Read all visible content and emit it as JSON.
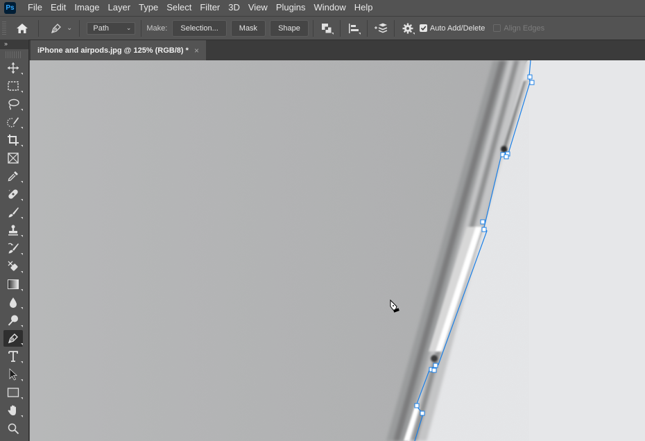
{
  "app": {
    "logo_text": "Ps",
    "menu": [
      "File",
      "Edit",
      "Image",
      "Layer",
      "Type",
      "Select",
      "Filter",
      "3D",
      "View",
      "Plugins",
      "Window",
      "Help"
    ]
  },
  "options_bar": {
    "home_icon": "home-icon",
    "tool_icon": "pen-tool-icon",
    "mode_select": {
      "value": "Path"
    },
    "make_label": "Make:",
    "buttons": {
      "selection": "Selection...",
      "mask": "Mask",
      "shape": "Shape"
    },
    "icons": [
      "path-operations-icon",
      "path-alignment-icon",
      "path-arrangement-icon",
      "gear-icon"
    ],
    "auto_add_delete": {
      "label": "Auto Add/Delete",
      "checked": true
    },
    "align_edges": {
      "label": "Align Edges",
      "checked": false,
      "enabled": false
    }
  },
  "document_tab": {
    "title": "iPhone and airpods.jpg @ 125% (RGB/8) *",
    "close_glyph": "×"
  },
  "toolbar": {
    "collapse_glyph": "››",
    "tools": [
      {
        "name": "move-tool",
        "active": false
      },
      {
        "name": "rectangular-marquee-tool",
        "active": false
      },
      {
        "name": "lasso-tool",
        "active": false
      },
      {
        "name": "object-selection-tool",
        "active": false
      },
      {
        "name": "crop-tool",
        "active": false
      },
      {
        "name": "frame-tool",
        "active": false
      },
      {
        "name": "eyedropper-tool",
        "active": false
      },
      {
        "name": "spot-healing-brush-tool",
        "active": false
      },
      {
        "name": "brush-tool",
        "active": false
      },
      {
        "name": "clone-stamp-tool",
        "active": false
      },
      {
        "name": "history-brush-tool",
        "active": false
      },
      {
        "name": "eraser-tool",
        "active": false
      },
      {
        "name": "gradient-tool",
        "active": false
      },
      {
        "name": "blur-tool",
        "active": false
      },
      {
        "name": "dodge-tool",
        "active": false
      },
      {
        "name": "pen-tool",
        "active": true
      },
      {
        "name": "type-tool",
        "active": false
      },
      {
        "name": "path-selection-tool",
        "active": false
      },
      {
        "name": "rectangle-tool",
        "active": false
      },
      {
        "name": "hand-tool",
        "active": false
      },
      {
        "name": "zoom-tool",
        "active": false
      }
    ]
  },
  "canvas": {
    "path_color": "#1a7fe6",
    "cursor": "pen-cursor"
  }
}
